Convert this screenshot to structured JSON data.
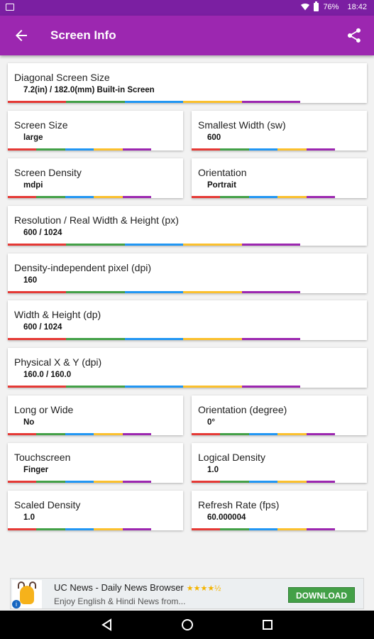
{
  "status_bar": {
    "battery": "76%",
    "time": "18:42"
  },
  "app_bar": {
    "title": "Screen Info"
  },
  "colors": {
    "status_bar": "#7b1fa2",
    "app_bar": "#9c27b0",
    "bar_segments": [
      "#e53935",
      "#43a047",
      "#2196f3",
      "#fbc02d",
      "#9c27b0"
    ]
  },
  "icons": {
    "back": "arrow-left-icon",
    "share": "share-icon",
    "nav": [
      "back-triangle-icon",
      "home-circle-icon",
      "recents-square-icon"
    ]
  },
  "cards": [
    {
      "label": "Diagonal Screen Size",
      "value": "7.2(in) / 182.0(mm) Built-in Screen"
    },
    {
      "label": "Screen Size",
      "value": "large"
    },
    {
      "label": "Smallest Width (sw)",
      "value": "600"
    },
    {
      "label": "Screen Density",
      "value": "mdpi"
    },
    {
      "label": "Orientation",
      "value": "Portrait"
    },
    {
      "label": "Resolution / Real Width & Height (px)",
      "value": "600 / 1024"
    },
    {
      "label": "Density-independent pixel (dpi)",
      "value": "160"
    },
    {
      "label": "Width & Height (dp)",
      "value": "600 / 1024"
    },
    {
      "label": "Physical X & Y (dpi)",
      "value": "160.0 / 160.0"
    },
    {
      "label": "Long or Wide",
      "value": "No"
    },
    {
      "label": "Orientation (degree)",
      "value": "0°"
    },
    {
      "label": "Touchscreen",
      "value": "Finger"
    },
    {
      "label": "Logical Density",
      "value": "1.0"
    },
    {
      "label": "Scaled Density",
      "value": "1.0"
    },
    {
      "label": "Refresh Rate (fps)",
      "value": "60.000004"
    }
  ],
  "ad": {
    "title": "UC News - Daily News Browser",
    "stars": "★★★★½",
    "rating": 4.5,
    "subtitle": "Enjoy English & Hindi News from...",
    "button": "DOWNLOAD",
    "info_glyph": "i"
  }
}
